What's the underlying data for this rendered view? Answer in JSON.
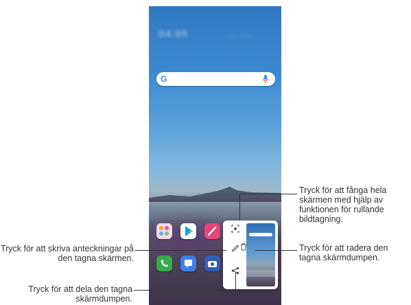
{
  "callouts": {
    "capture_scroll": "Tryck för att fånga hela skärmen med hjälp av funktionen för rullande bildtagning.",
    "write_notes": "Tryck för att skriva anteckningar på den tagna skärmen.",
    "delete": "Tryck för att radera den tagna skärmdumpen.",
    "share": "Tryck för att dela den tagna skärmdumpen."
  },
  "search": {
    "logo_letter": "G"
  },
  "colors": {
    "callout_text": "#333333",
    "google_blue": "#4285f4",
    "phone_app": "#3aa84a",
    "play_store": "#ffffff",
    "pen_app": "#e6457a",
    "clock_app": "#2d6fd3",
    "settings_app": "#555a60"
  },
  "icons": [
    "gallery-app-icon",
    "play-store-icon",
    "qslide-pen-icon",
    "clock-app-icon",
    "settings-app-icon",
    "phone-app-icon",
    "messages-app-icon",
    "camera-app-icon",
    "scroll-capture-icon",
    "edit-pen-icon",
    "trash-icon",
    "share-icon",
    "mic-icon"
  ]
}
